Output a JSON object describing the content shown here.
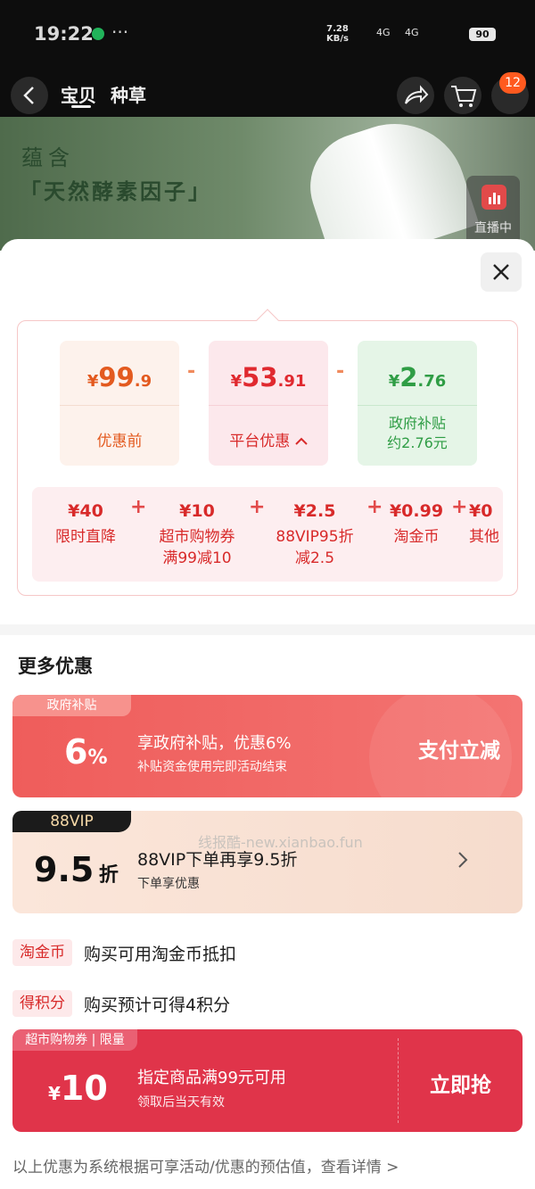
{
  "status_bar": {
    "time": "19:22",
    "dots": "···",
    "rate_value": "7.28",
    "rate_unit": "KB/s",
    "signal1": "4G",
    "signal2": "4G",
    "battery": "90"
  },
  "nav": {
    "tab_item": "宝贝",
    "tab_review": "种草",
    "cart_badge": "12"
  },
  "hero": {
    "line1": "蕴含",
    "line2": "「天然酵素因子」",
    "live_label": "直播中"
  },
  "breakdown": {
    "before": {
      "currency": "¥",
      "int": "99",
      "dec": ".9",
      "label": "优惠前"
    },
    "minus": "-",
    "platform": {
      "currency": "¥",
      "int": "53",
      "dec": ".91",
      "label": "平台优惠"
    },
    "gov": {
      "currency": "¥",
      "int": "2",
      "dec": ".76",
      "label1": "政府补贴",
      "label2": "约2.76元"
    },
    "details": [
      {
        "value": "¥40",
        "name1": "限时直降",
        "name2": ""
      },
      {
        "value": "¥10",
        "name1": "超市购物券",
        "name2": "满99减10"
      },
      {
        "value": "¥2.5",
        "name1": "88VIP95折",
        "name2": "减2.5"
      },
      {
        "value": "¥0.99",
        "name1": "淘金币",
        "name2": ""
      },
      {
        "value": "¥0",
        "name1": "其他",
        "name2": ""
      }
    ],
    "plus": "+"
  },
  "more": {
    "title": "更多优惠",
    "gov_card": {
      "tag": "政府补贴",
      "big": "6",
      "unit": "%",
      "line1": "享政府补贴，优惠6%",
      "line2": "补贴资金使用完即活动结束",
      "action": "支付立减"
    },
    "vip_card": {
      "tag": "88VIP",
      "big": "9.5",
      "unit": "折",
      "line1": "88VIP下单再享9.5折",
      "line2": "下单享优惠",
      "watermark": "线报酷-new.xianbao.fun"
    },
    "coin_row": {
      "chip": "淘金币",
      "text": "购买可用淘金币抵扣"
    },
    "points_row": {
      "chip": "得积分",
      "text": "购买预计可得4积分"
    },
    "coupon_card": {
      "tag": "超市购物券 | 限量",
      "currency": "¥",
      "amount": "10",
      "line1": "指定商品满99元可用",
      "line2": "领取后当天有效",
      "action": "立即抢"
    }
  },
  "footer": {
    "text": "以上优惠为系统根据可享活动/优惠的预估值，查看详情 >"
  },
  "colors": {
    "accent_red": "#e0292f",
    "orange": "#e35a1f",
    "green": "#2f9d45",
    "coupon_red": "#e0344a"
  }
}
